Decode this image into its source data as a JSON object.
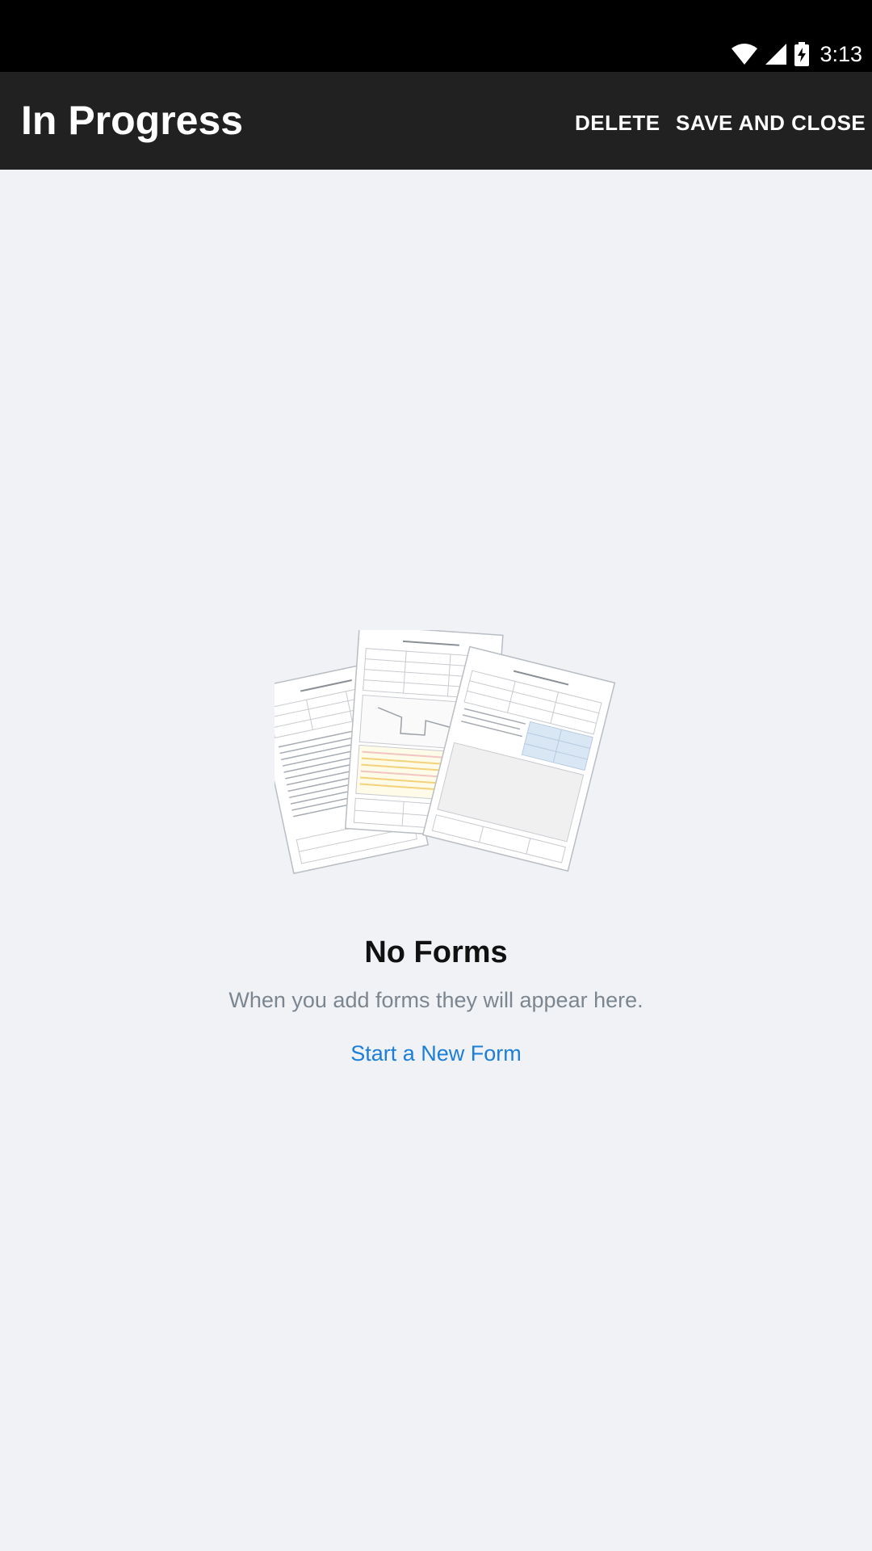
{
  "status_bar": {
    "time": "3:13",
    "icons": [
      "wifi-icon",
      "cell-signal-icon",
      "battery-charging-icon"
    ]
  },
  "app_bar": {
    "title": "In Progress",
    "delete_label": "DELETE",
    "save_close_label": "SAVE AND CLOSE"
  },
  "empty_state": {
    "illustration_icon": "form-documents-icon",
    "title": "No Forms",
    "subtitle": "When you add forms they will appear here.",
    "link_label": "Start a New Form"
  },
  "colors": {
    "status_bar_bg": "#000000",
    "app_bar_bg": "#212121",
    "page_bg": "#f0f2f6",
    "link": "#1b7fd8",
    "subtitle": "#7c8690"
  }
}
